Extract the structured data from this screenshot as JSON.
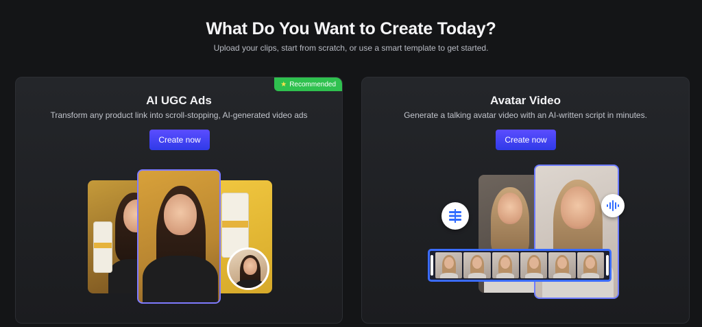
{
  "header": {
    "title": "What Do You Want to Create Today?",
    "subtitle": "Upload your clips, start from scratch, or use a smart template to get started."
  },
  "cards": [
    {
      "title": "AI UGC Ads",
      "description": "Transform any product link into scroll-stopping, AI-generated video ads",
      "button_label": "Create now",
      "badge": "Recommended",
      "badge_icon": "star-icon",
      "badge_color": "#2fc14f"
    },
    {
      "title": "Avatar Video",
      "description": "Generate a talking avatar video with an AI-written script in minutes.",
      "button_label": "Create now",
      "icons": [
        "script-icon",
        "audio-wave-icon"
      ]
    }
  ],
  "colors": {
    "background": "#141517",
    "card": "#24262a",
    "button": "#3f44f0",
    "selection": "#7f7bff",
    "filmstrip": "#3b6cff"
  }
}
